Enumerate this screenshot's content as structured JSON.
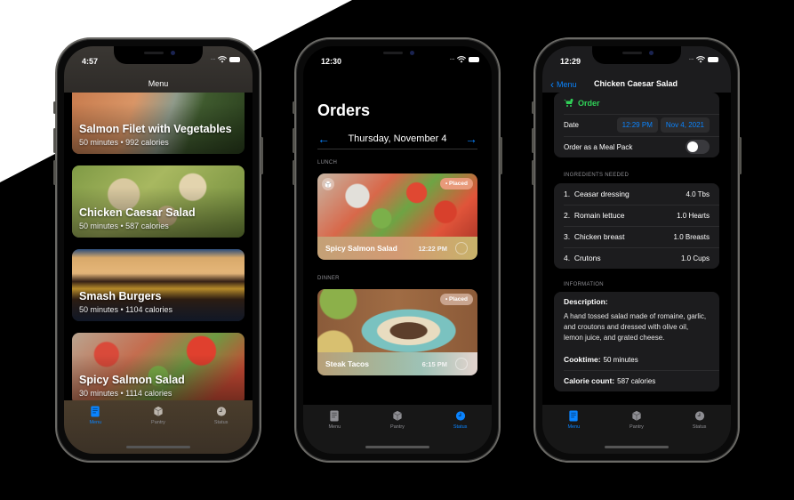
{
  "colors": {
    "background_dark": "#000000",
    "background_light": "#ffffff",
    "accent_blue": "#0a84ff",
    "order_green": "#30d158",
    "tab_inactive": "#8e8e93"
  },
  "tabs": [
    {
      "label": "Menu",
      "icon": "menu-doc-icon"
    },
    {
      "label": "Pantry",
      "icon": "package-icon"
    },
    {
      "label": "Status",
      "icon": "clock-icon"
    }
  ],
  "phone_menu": {
    "status_time": "4:57",
    "nav_title": "Menu",
    "active_tab": "Menu",
    "items": [
      {
        "name": "Salmon Filet with Vegetables",
        "meta": "50 minutes • 992 calories"
      },
      {
        "name": "Chicken Caesar Salad",
        "meta": "50 minutes • 587 calories"
      },
      {
        "name": "Smash Burgers",
        "meta": "50 minutes • 1104 calories"
      },
      {
        "name": "Spicy Salmon Salad",
        "meta": "30 minutes • 1114 calories"
      }
    ]
  },
  "phone_orders": {
    "status_time": "12:30",
    "title": "Orders",
    "date": "Thursday, November 4",
    "prev_icon": "arrow-left-icon",
    "next_icon": "arrow-right-icon",
    "active_tab": "Status",
    "sections": [
      {
        "label": "LUNCH",
        "order": {
          "name": "Spicy Salmon Salad",
          "time": "12:22 PM",
          "status": "Placed",
          "meal_pack": true
        }
      },
      {
        "label": "DINNER",
        "order": {
          "name": "Steak Tacos",
          "time": "6:15 PM",
          "status": "Placed",
          "meal_pack": false
        }
      }
    ]
  },
  "phone_detail": {
    "status_time": "12:29",
    "back_label": "Menu",
    "nav_title": "Chicken Caesar Salad",
    "active_tab": "Menu",
    "order": {
      "header": "Order",
      "date_label": "Date",
      "time_value": "12:29 PM",
      "date_value": "Nov 4, 2021",
      "meal_pack_label": "Order as a Meal Pack",
      "meal_pack_on": false
    },
    "ingredients_header": "INGREDIENTS NEEDED",
    "ingredients": [
      {
        "index": "1.",
        "name": "Ceasar dressing",
        "amount": "4.0 Tbs"
      },
      {
        "index": "2.",
        "name": "Romain lettuce",
        "amount": "1.0 Hearts"
      },
      {
        "index": "3.",
        "name": "Chicken breast",
        "amount": "1.0 Breasts"
      },
      {
        "index": "4.",
        "name": "Crutons",
        "amount": "1.0 Cups"
      }
    ],
    "information_header": "INFORMATION",
    "description_label": "Description:",
    "description": "A hand tossed salad made of romaine, garlic, and croutons and dressed with olive oil, lemon juice, and grated cheese.",
    "cooktime_label": "Cooktime:",
    "cooktime_value": "50 minutes",
    "calorie_label": "Calorie count:",
    "calorie_value": "587 calories"
  }
}
